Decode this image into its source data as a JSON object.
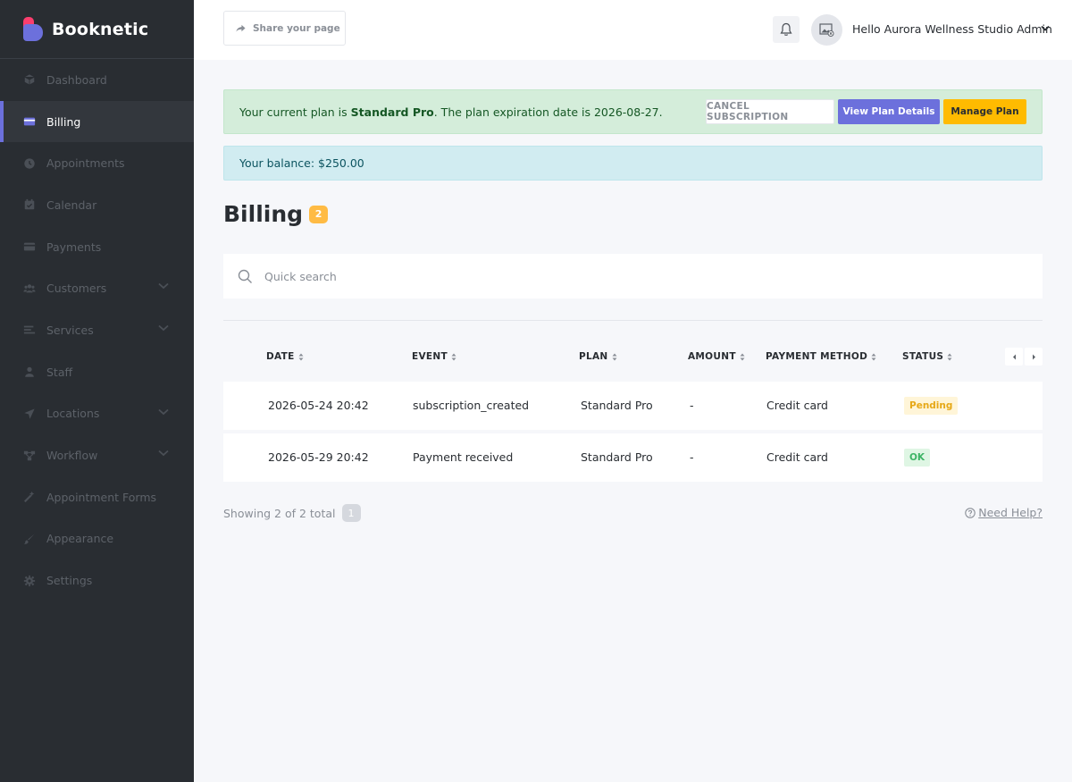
{
  "brand": {
    "name": "Booknetic"
  },
  "sidebar": {
    "items": [
      {
        "label": "Dashboard",
        "icon": "cube-icon"
      },
      {
        "label": "Billing",
        "icon": "credit-card-icon"
      },
      {
        "label": "Appointments",
        "icon": "clock-icon"
      },
      {
        "label": "Calendar",
        "icon": "calendar-icon"
      },
      {
        "label": "Payments",
        "icon": "payment-icon"
      },
      {
        "label": "Customers",
        "icon": "users-icon"
      },
      {
        "label": "Services",
        "icon": "list-icon"
      },
      {
        "label": "Staff",
        "icon": "user-icon"
      },
      {
        "label": "Locations",
        "icon": "location-arrow-icon"
      },
      {
        "label": "Workflow",
        "icon": "workflow-icon"
      },
      {
        "label": "Appointment Forms",
        "icon": "magic-wand-icon"
      },
      {
        "label": "Appearance",
        "icon": "brush-icon"
      },
      {
        "label": "Settings",
        "icon": "gear-icon"
      }
    ],
    "active": "Billing"
  },
  "header": {
    "share_label": "Share your page",
    "greeting": "Hello Aurora Wellness Studio Admin"
  },
  "plan_alert": {
    "prefix": "Your current plan is ",
    "plan_name": "Standard Pro",
    "suffix": ". The plan expiration date is 2026-08-27.",
    "cancel_label": "CANCEL SUBSCRIPTION",
    "view_label": "View Plan Details",
    "manage_label": "Manage Plan"
  },
  "balance_alert": {
    "text": "Your balance: $250.00"
  },
  "page": {
    "title": "Billing",
    "count": "2"
  },
  "search": {
    "placeholder": "Quick search"
  },
  "table": {
    "columns": [
      "DATE",
      "EVENT",
      "PLAN",
      "AMOUNT",
      "PAYMENT METHOD",
      "STATUS"
    ],
    "rows": [
      {
        "date": "2026-05-24 20:42",
        "event": "subscription_created",
        "plan": "Standard Pro",
        "amount": "-",
        "method": "Credit card",
        "status": "Pending"
      },
      {
        "date": "2026-05-29 20:42",
        "event": "Payment received",
        "plan": "Standard Pro",
        "amount": "-",
        "method": "Credit card",
        "status": "OK"
      }
    ]
  },
  "footer": {
    "showing": "Showing 2 of 2 total",
    "page": "1",
    "help": "Need Help?"
  },
  "colors": {
    "accent": "#6c70dc",
    "warning": "#ffbb00",
    "sidebar_bg": "#292d32",
    "brand_pink": "#fb3e6e"
  }
}
